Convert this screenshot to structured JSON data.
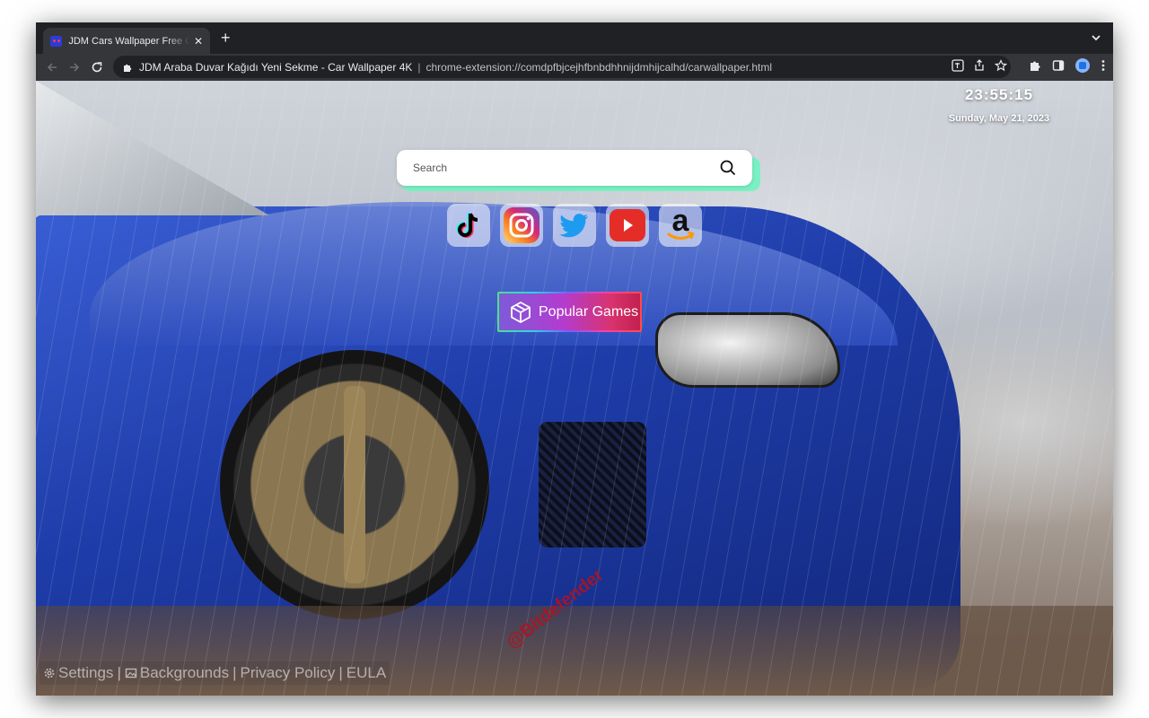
{
  "browser": {
    "tab": {
      "title": "JDM Cars Wallpaper Free Chrome Extension"
    },
    "new_tab_glyph": "+",
    "close_glyph": "✕",
    "omnibox": {
      "page_title": "JDM Araba Duvar Kağıdı Yeni Sekme - Car Wallpaper 4K",
      "separator": "|",
      "url": "chrome-extension://comdpfbjcejhfbnbdhhnijdmhijcalhd/carwallpaper.html"
    }
  },
  "clock": {
    "time": "23:55:15",
    "date": "Sunday, May 21, 2023"
  },
  "search": {
    "placeholder": "Search"
  },
  "shortcuts": [
    {
      "name": "TikTok",
      "icon": "tiktok-icon"
    },
    {
      "name": "Instagram",
      "icon": "instagram-icon"
    },
    {
      "name": "Twitter",
      "icon": "twitter-icon"
    },
    {
      "name": "YouTube",
      "icon": "youtube-icon"
    },
    {
      "name": "Amazon",
      "icon": "amazon-icon"
    }
  ],
  "games_button": {
    "label": "Popular Games",
    "icon": "cube-icon"
  },
  "footer": {
    "settings": "Settings",
    "backgrounds": "Backgrounds",
    "privacy": "Privacy Policy",
    "eula": "EULA",
    "separator": "|"
  },
  "watermark": {
    "text": "@Bitdefender"
  },
  "colors": {
    "search_accent": "#7af0c4",
    "games_gradient_start": "#7e5ad9",
    "games_gradient_end": "#c2204f",
    "chrome_dark": "#202124",
    "chrome_toolbar": "#35363a"
  }
}
